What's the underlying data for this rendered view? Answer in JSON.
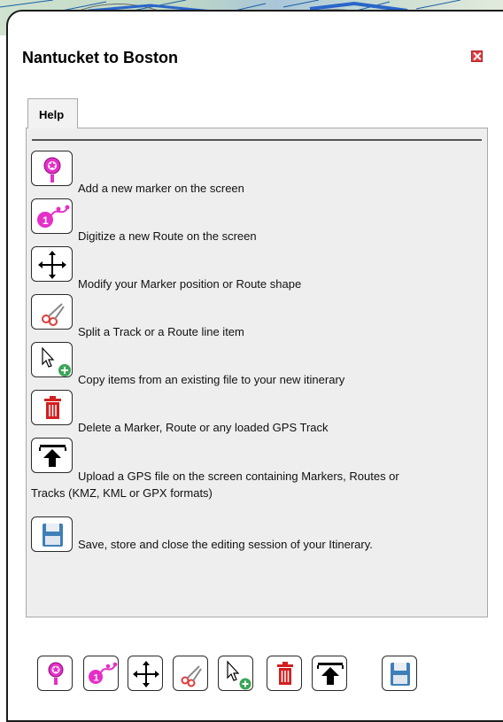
{
  "dialog": {
    "title": "Nantucket to Boston",
    "close_icon": "close-icon",
    "accent_close": "#e03a3f"
  },
  "tabs": [
    {
      "label": "Help",
      "selected": true
    }
  ],
  "help_items": [
    {
      "icon": "add-marker-icon",
      "text": "Add a new marker on the screen"
    },
    {
      "icon": "digitize-route-icon",
      "text": "Digitize a new Route on the screen"
    },
    {
      "icon": "move-icon",
      "text": "Modify your Marker position or Route shape"
    },
    {
      "icon": "scissors-icon",
      "text": "Split a Track or a Route line item"
    },
    {
      "icon": "copy-items-icon",
      "text": "Copy items from an existing file to your new itinerary"
    },
    {
      "icon": "trash-icon",
      "text": "Delete a Marker, Route or any loaded GPS Track"
    },
    {
      "icon": "upload-icon",
      "text_line1": "Upload a GPS file on the screen containing Markers, Routes or",
      "text_line2": "Tracks (KMZ, KML or GPX formats)"
    },
    {
      "icon": "save-icon",
      "text": "Save, store and close the editing session of your Itinerary."
    }
  ],
  "toolbar": [
    {
      "icon": "add-marker-icon"
    },
    {
      "icon": "digitize-route-icon"
    },
    {
      "icon": "move-icon"
    },
    {
      "icon": "scissors-icon"
    },
    {
      "icon": "copy-items-icon"
    },
    {
      "icon": "trash-icon"
    },
    {
      "icon": "upload-icon"
    },
    {
      "icon": "save-icon"
    }
  ],
  "colors": {
    "marker_pink": "#e62ec8",
    "trash_red": "#d21f1f",
    "save_blue": "#3f7fb8",
    "copy_green": "#3aa655"
  }
}
